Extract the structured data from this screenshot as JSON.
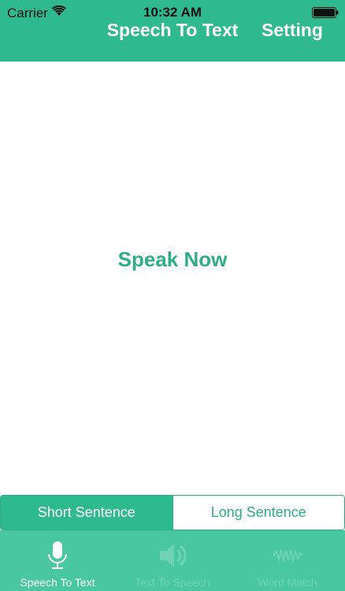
{
  "status_bar": {
    "carrier": "Carrier",
    "time": "10:32 AM"
  },
  "header": {
    "title": "Speech To Text",
    "setting_label": "Setting"
  },
  "main": {
    "prompt": "Speak Now"
  },
  "segment": {
    "options": [
      {
        "label": "Short Sentence",
        "selected": true
      },
      {
        "label": "Long Sentence",
        "selected": false
      }
    ]
  },
  "tabbar": {
    "tabs": [
      {
        "label": "Speech To Text",
        "icon": "microphone-icon",
        "active": true
      },
      {
        "label": "Text To Speech",
        "icon": "speaker-icon",
        "active": false
      },
      {
        "label": "Word Match",
        "icon": "waveform-icon",
        "active": false
      }
    ]
  },
  "colors": {
    "primary": "#2fba8d",
    "accent_text": "#2fae86",
    "tabbar": "#49c79f",
    "inactive_tab": "#6fd3b3"
  }
}
